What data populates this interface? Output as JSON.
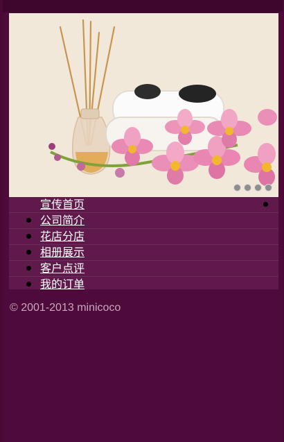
{
  "nav": {
    "items": [
      {
        "label": "宣传首页"
      },
      {
        "label": "公司简介"
      },
      {
        "label": "花店分店"
      },
      {
        "label": "相册展示"
      },
      {
        "label": "客户点评"
      },
      {
        "label": "我的订单"
      }
    ]
  },
  "slider": {
    "dot_count": 4
  },
  "footer": {
    "copyright": "© 2001-2013 minicoco"
  },
  "colors": {
    "background": "#4e0a3a",
    "menu_bg": "#5f1a4b",
    "link": "#ffffff",
    "footer_text": "#c9a8bd"
  }
}
